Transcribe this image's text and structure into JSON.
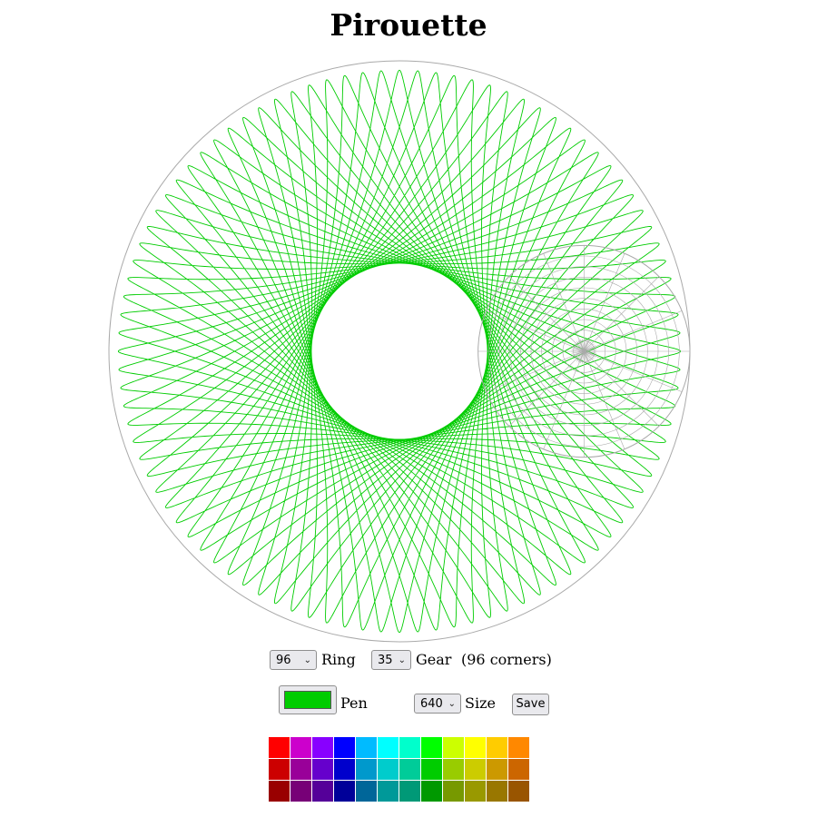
{
  "title": "Pirouette",
  "controls": {
    "ring_value": "96",
    "ring_label": "Ring",
    "gear_value": "35",
    "gear_label": "Gear",
    "corners_text": "(96 corners)",
    "pen_label": "Pen",
    "size_value": "640",
    "size_label": "Size",
    "save_label": "Save"
  },
  "pattern": {
    "ring_teeth": 96,
    "gear_teeth": 35,
    "pen_color": "#00cc00",
    "guide_color": "#aaaaaa"
  },
  "palette": [
    [
      "#ff0000",
      "#cc00cc",
      "#8800ff",
      "#0000ff",
      "#00bbff",
      "#00ffff",
      "#00ffcc",
      "#00ff00",
      "#ccff00",
      "#ffff00",
      "#ffcc00",
      "#ff8800"
    ],
    [
      "#cc0000",
      "#990099",
      "#6600cc",
      "#0000cc",
      "#0099cc",
      "#00cccc",
      "#00cc99",
      "#00cc00",
      "#99cc00",
      "#cccc00",
      "#cc9900",
      "#cc6600"
    ],
    [
      "#990000",
      "#770077",
      "#550099",
      "#000099",
      "#006699",
      "#009999",
      "#009977",
      "#009900",
      "#779900",
      "#999900",
      "#997700",
      "#995500"
    ]
  ]
}
